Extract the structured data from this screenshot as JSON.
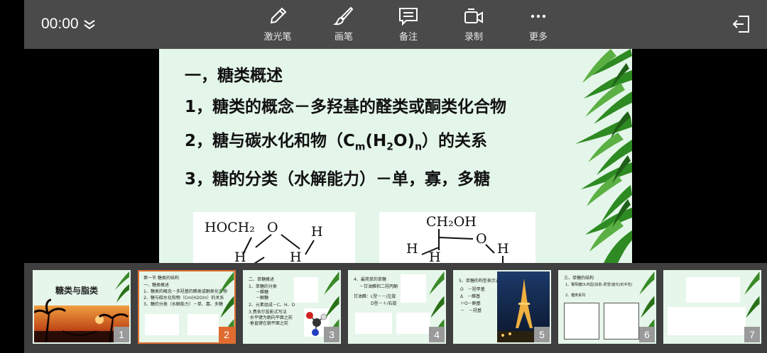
{
  "toolbar": {
    "timer": "00:00",
    "tools": [
      {
        "label": "激光笔",
        "icon": "laser-pen-icon"
      },
      {
        "label": "画笔",
        "icon": "brush-icon"
      },
      {
        "label": "备注",
        "icon": "notes-icon"
      },
      {
        "label": "录制",
        "icon": "record-icon"
      },
      {
        "label": "更多",
        "icon": "more-icon"
      }
    ],
    "exit_icon": "exit-icon"
  },
  "slide": {
    "heading": "一，糖类概述",
    "line1": "1，糖类的概念－多羟基的醛类或酮类化合物",
    "line2_pre": "2，糖与碳水化和物（C",
    "line2_m": "m",
    "line2_mid": "(H",
    "line2_2": "2",
    "line2_o": "O)",
    "line2_n": "n",
    "line2_post": "）的关系",
    "line3": "3，糖的分类（水解能力）－单，寡，多糖",
    "struct1_labels": [
      "HOCH₂",
      "O",
      "H",
      "H",
      "H"
    ],
    "struct2_labels": [
      "CH₂OH",
      "O",
      "H",
      "H",
      "H"
    ]
  },
  "thumbnails": [
    {
      "num": "1",
      "title": "糖类与脂类",
      "selected": false
    },
    {
      "num": "2",
      "title": "第一节 糖类的结构",
      "selected": true,
      "lines": [
        "一、糖类概述",
        "1、糖类的概念－多羟基的醛类或酮类化合物",
        "2、糖与碳水化和物（Cm(H2O)n）的关系",
        "3、糖的分类（水解能力）－单、寡、多糖"
      ]
    },
    {
      "num": "3",
      "title": "二、单糖概述",
      "selected": false,
      "lines": [
        "1、单糖的分类",
        "－醛糖",
        "－酮糖",
        "2、元素组成－C、H、O",
        "3.费舍尔投影式写法",
        "·水平键为朝向平面之前",
        "·垂直键在朝平面之前"
      ]
    },
    {
      "num": "4",
      "title": "4、最简单的单糖",
      "selected": false,
      "lines": [
        "－甘油醛和二羟丙酮",
        "甘油醛：L型－－/左旋",
        "D型－＋/右旋"
      ]
    },
    {
      "num": "5",
      "title": "5、单糖的构型表示式",
      "selected": false,
      "lines": [
        "O　－羟甲基",
        "Δ　－醛基",
        "＝O－酮基",
        "－　－羟基"
      ]
    },
    {
      "num": "6",
      "title": "三、单糖的结构",
      "selected": false,
      "lines": [
        "1、葡萄糖DL构型(投影-费雪(旋光)的手性)",
        "2、糖类系列"
      ]
    },
    {
      "num": "7",
      "title": "",
      "selected": false
    }
  ]
}
